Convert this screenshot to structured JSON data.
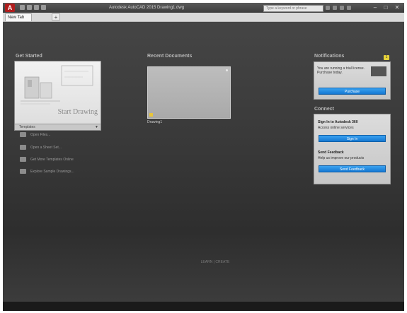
{
  "app": {
    "logo": "A",
    "title": "Autodesk AutoCAD 2015  Drawing1.dwg",
    "search_placeholder": "Type a keyword or phrase",
    "controls": [
      "–",
      "□",
      "✕"
    ]
  },
  "tabs": [
    {
      "label": "New Tab"
    }
  ],
  "tab_add": "+",
  "get_started": {
    "heading": "Get Started",
    "start_label": "Start Drawing",
    "template_label": "Templates",
    "links": [
      {
        "label": "Open Files..."
      },
      {
        "label": "Open a Sheet Set..."
      },
      {
        "label": "Get More Templates Online"
      },
      {
        "label": "Explore Sample Drawings..."
      }
    ]
  },
  "recent": {
    "heading": "Recent Documents",
    "items": [
      {
        "name": "Drawing1"
      }
    ]
  },
  "notifications": {
    "heading": "Notifications",
    "badge": "1",
    "message": "You are running a trial license. Purchase today.",
    "button": "Purchase"
  },
  "connect": {
    "heading": "Connect",
    "sign_in_title": "Sign In to Autodesk 360",
    "sign_in_text": "Access online services",
    "sign_in_button": "Sign In",
    "feedback_title": "Send Feedback",
    "feedback_text": "Help us improve our products",
    "feedback_button": "Send Feedback"
  },
  "footer": {
    "links": "LEARN  |  CREATE"
  }
}
